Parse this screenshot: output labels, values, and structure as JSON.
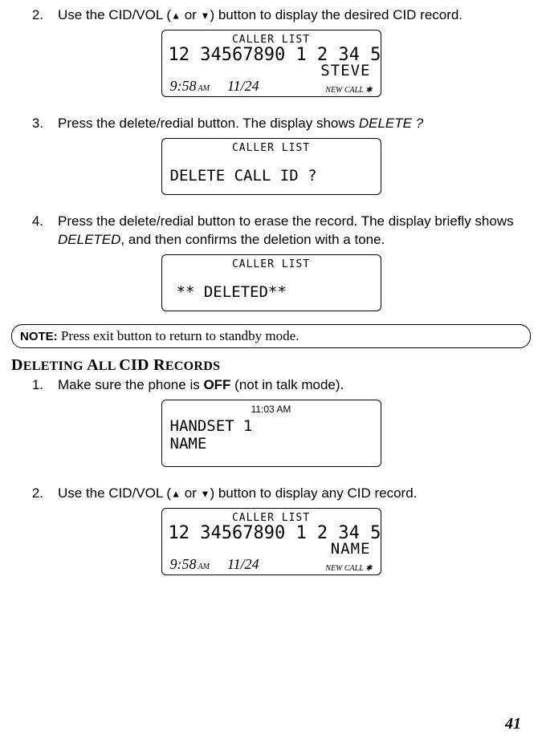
{
  "steps_a": {
    "s2": {
      "num": "2.",
      "pre": "Use the CID/VOL (",
      "mid": " or ",
      "post": ") button to display the desired CID record."
    },
    "s3": {
      "num": "3.",
      "pre": "Press the delete/redial button. The display shows ",
      "ital": "DELETE ?"
    },
    "s4": {
      "num": "4.",
      "pre": "Press the delete/redial button to erase the record. The display briefly shows ",
      "ital": "DELETED",
      "post": ", and then confirms the deletion with a tone."
    }
  },
  "note": {
    "label": "NOTE:",
    "text": " Press exit button to return to standby mode."
  },
  "section_b": {
    "title_caps": "D",
    "title_rest": "ELETING ",
    "word2_caps": "A",
    "word2_rest": "LL ",
    "word3": "CID ",
    "word4_caps": "R",
    "word4_rest": "ECORDS"
  },
  "steps_b": {
    "s1": {
      "num": "1.",
      "pre": "Make sure the phone is ",
      "bold": "OFF",
      "post": " (not in talk mode)."
    },
    "s2": {
      "num": "2.",
      "pre": "Use the CID/VOL (",
      "mid": " or ",
      "post": ") button to display any CID record."
    }
  },
  "lcd1": {
    "head": "CALLER LIST",
    "big": "12 34567890 1 2 34 5",
    "name": "STEVE",
    "time": "9:58",
    "ampm": "AM",
    "date": "11/24",
    "flags": "NEW  CALL ✱"
  },
  "lcd2": {
    "head": "CALLER LIST",
    "mid": "DELETE CALL ID ?"
  },
  "lcd3": {
    "head": "CALLER LIST",
    "mid": "** DELETED**"
  },
  "lcd4": {
    "time": "11:03 AM",
    "line1": "HANDSET 1",
    "line2": "NAME"
  },
  "lcd5": {
    "head": "CALLER LIST",
    "big": "12 34567890 1 2 34 5",
    "name": "NAME",
    "time": "9:58",
    "ampm": "AM",
    "date": "11/24",
    "flags": "NEW  CALL ✱"
  },
  "pagenum": "41"
}
